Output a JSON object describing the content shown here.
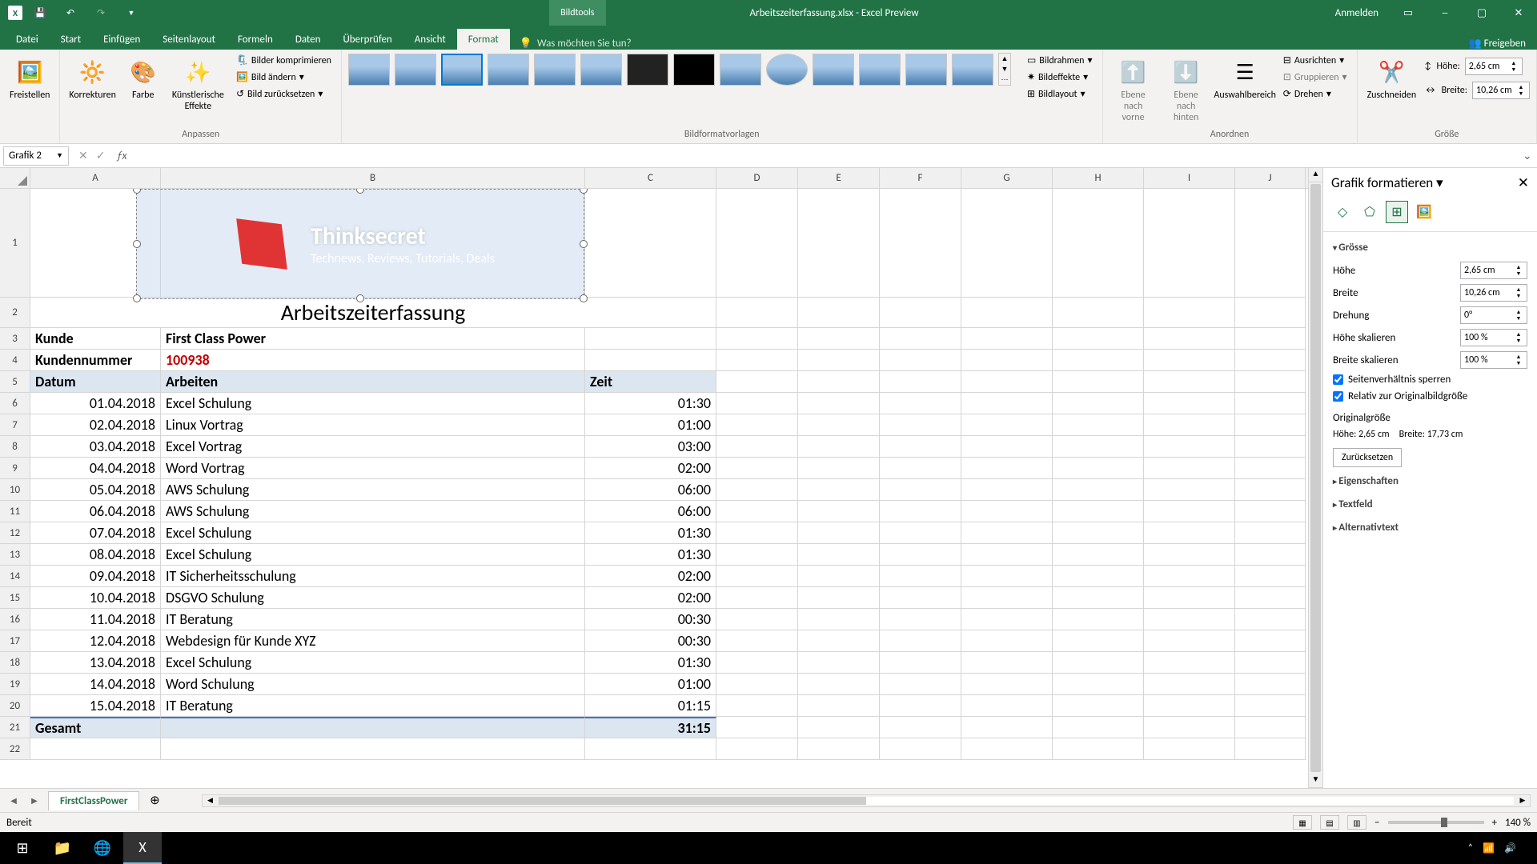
{
  "titlebar": {
    "bildtools": "Bildtools",
    "doc_title": "Arbeitszeiterfassung.xlsx - Excel Preview",
    "anmelden": "Anmelden"
  },
  "tabs": {
    "datei": "Datei",
    "start": "Start",
    "einfuegen": "Einfügen",
    "seitenlayout": "Seitenlayout",
    "formeln": "Formeln",
    "daten": "Daten",
    "ueberpruefen": "Überprüfen",
    "ansicht": "Ansicht",
    "format": "Format",
    "tell_me": "Was möchten Sie tun?",
    "freigeben": "Freigeben"
  },
  "ribbon": {
    "freistellen": "Freistellen",
    "korrekturen": "Korrekturen",
    "farbe": "Farbe",
    "effekte": "Künstlerische Effekte",
    "komprimieren": "Bilder komprimieren",
    "aendern": "Bild ändern",
    "zuruecksetzen": "Bild zurücksetzen",
    "anpassen": "Anpassen",
    "formatvorlagen": "Bildformatvorlagen",
    "rahmen": "Bildrahmen",
    "bildeffekte": "Bildeffekte",
    "bildlayout": "Bildlayout",
    "vorne": "Ebene nach vorne",
    "hinten": "Ebene nach hinten",
    "auswahl": "Auswahlbereich",
    "ausrichten": "Ausrichten",
    "gruppieren": "Gruppieren",
    "drehen": "Drehen",
    "anordnen": "Anordnen",
    "zuschneiden": "Zuschneiden",
    "hoehe": "Höhe:",
    "breite": "Breite:",
    "hoehe_val": "2,65 cm",
    "breite_val": "10,26 cm",
    "groesse": "Größe"
  },
  "namebox": "Grafik 2",
  "cols": [
    "A",
    "B",
    "C",
    "D",
    "E",
    "F",
    "G",
    "H",
    "I",
    "J"
  ],
  "sheet": {
    "title_row": "Arbeitszeiterfassung",
    "kunde_label": "Kunde",
    "kunde_value": "First Class Power",
    "kundennr_label": "Kundennummer",
    "kundennr_value": "100938",
    "h_datum": "Datum",
    "h_arbeiten": "Arbeiten",
    "h_zeit": "Zeit",
    "logo_main": "Thinksecret",
    "logo_sub": "Technews, Reviews, Tutorials, Deals",
    "rows": [
      {
        "d": "01.04.2018",
        "a": "Excel Schulung",
        "z": "01:30"
      },
      {
        "d": "02.04.2018",
        "a": "Linux Vortrag",
        "z": "01:00"
      },
      {
        "d": "03.04.2018",
        "a": "Excel Vortrag",
        "z": "03:00"
      },
      {
        "d": "04.04.2018",
        "a": "Word Vortrag",
        "z": "02:00"
      },
      {
        "d": "05.04.2018",
        "a": "AWS Schulung",
        "z": "06:00"
      },
      {
        "d": "06.04.2018",
        "a": "AWS Schulung",
        "z": "06:00"
      },
      {
        "d": "07.04.2018",
        "a": "Excel Schulung",
        "z": "01:30"
      },
      {
        "d": "08.04.2018",
        "a": "Excel Schulung",
        "z": "01:30"
      },
      {
        "d": "09.04.2018",
        "a": "IT Sicherheitsschulung",
        "z": "02:00"
      },
      {
        "d": "10.04.2018",
        "a": "DSGVO Schulung",
        "z": "02:00"
      },
      {
        "d": "11.04.2018",
        "a": "IT Beratung",
        "z": "00:30"
      },
      {
        "d": "12.04.2018",
        "a": "Webdesign für Kunde XYZ",
        "z": "00:30"
      },
      {
        "d": "13.04.2018",
        "a": "Excel Schulung",
        "z": "01:30"
      },
      {
        "d": "14.04.2018",
        "a": "Word Schulung",
        "z": "01:00"
      },
      {
        "d": "15.04.2018",
        "a": "IT Beratung",
        "z": "01:15"
      }
    ],
    "total_label": "Gesamt",
    "total_value": "31:15"
  },
  "pane": {
    "title": "Grafik formatieren",
    "groesse": "Grösse",
    "hoehe": "Höhe",
    "breite": "Breite",
    "drehung": "Drehung",
    "hoehe_skal": "Höhe skalieren",
    "breite_skal": "Breite skalieren",
    "lock": "Seitenverhältnis sperren",
    "relativ": "Relativ zur Originalbildgröße",
    "original": "Originalgröße",
    "orig_h_label": "Höhe:",
    "orig_h": "2,65 cm",
    "orig_b_label": "Breite:",
    "orig_b": "17,73 cm",
    "reset": "Zurücksetzen",
    "eigenschaften": "Eigenschaften",
    "textfeld": "Textfeld",
    "alt": "Alternativtext",
    "v_hoehe": "2,65 cm",
    "v_breite": "10,26 cm",
    "v_dreh": "0°",
    "v_hs": "100 %",
    "v_bs": "100 %"
  },
  "sheettab": "FirstClassPower",
  "status": {
    "bereit": "Bereit",
    "zoom": "140 %"
  },
  "tray": {
    "time": "",
    "date": ""
  }
}
